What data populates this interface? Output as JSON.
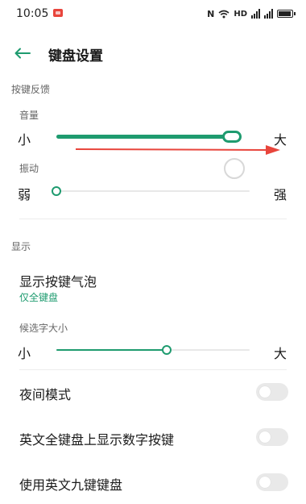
{
  "status_bar": {
    "time": "10:05",
    "network": "HD",
    "icons": [
      "record-icon",
      "nfc-icon",
      "wifi-icon",
      "signal-icon",
      "battery-icon"
    ]
  },
  "header": {
    "title": "键盘设置",
    "back_icon": "arrow-left-icon"
  },
  "sections": {
    "feedback": {
      "label": "按键反馈",
      "volume": {
        "label": "音量",
        "min_label": "小",
        "max_label": "大",
        "value": 0.99
      },
      "vibration": {
        "label": "振动",
        "min_label": "弱",
        "max_label": "强",
        "value": 0.0
      }
    },
    "display": {
      "label": "显示",
      "key_bubble": {
        "title": "显示按键气泡",
        "subtitle": "仅全键盘"
      },
      "candidate_size": {
        "label": "候选字大小",
        "min_label": "小",
        "max_label": "大",
        "value": 0.57
      },
      "night_mode": {
        "label": "夜间模式",
        "enabled": false
      },
      "show_numbers": {
        "label": "英文全键盘上显示数字按键",
        "enabled": false
      },
      "nine_key": {
        "label": "使用英文九键键盘",
        "enabled": false
      }
    }
  },
  "colors": {
    "accent": "#1e9b6f",
    "annotation_arrow": "#e8453c",
    "toggle_off": "#e9e9e9"
  }
}
